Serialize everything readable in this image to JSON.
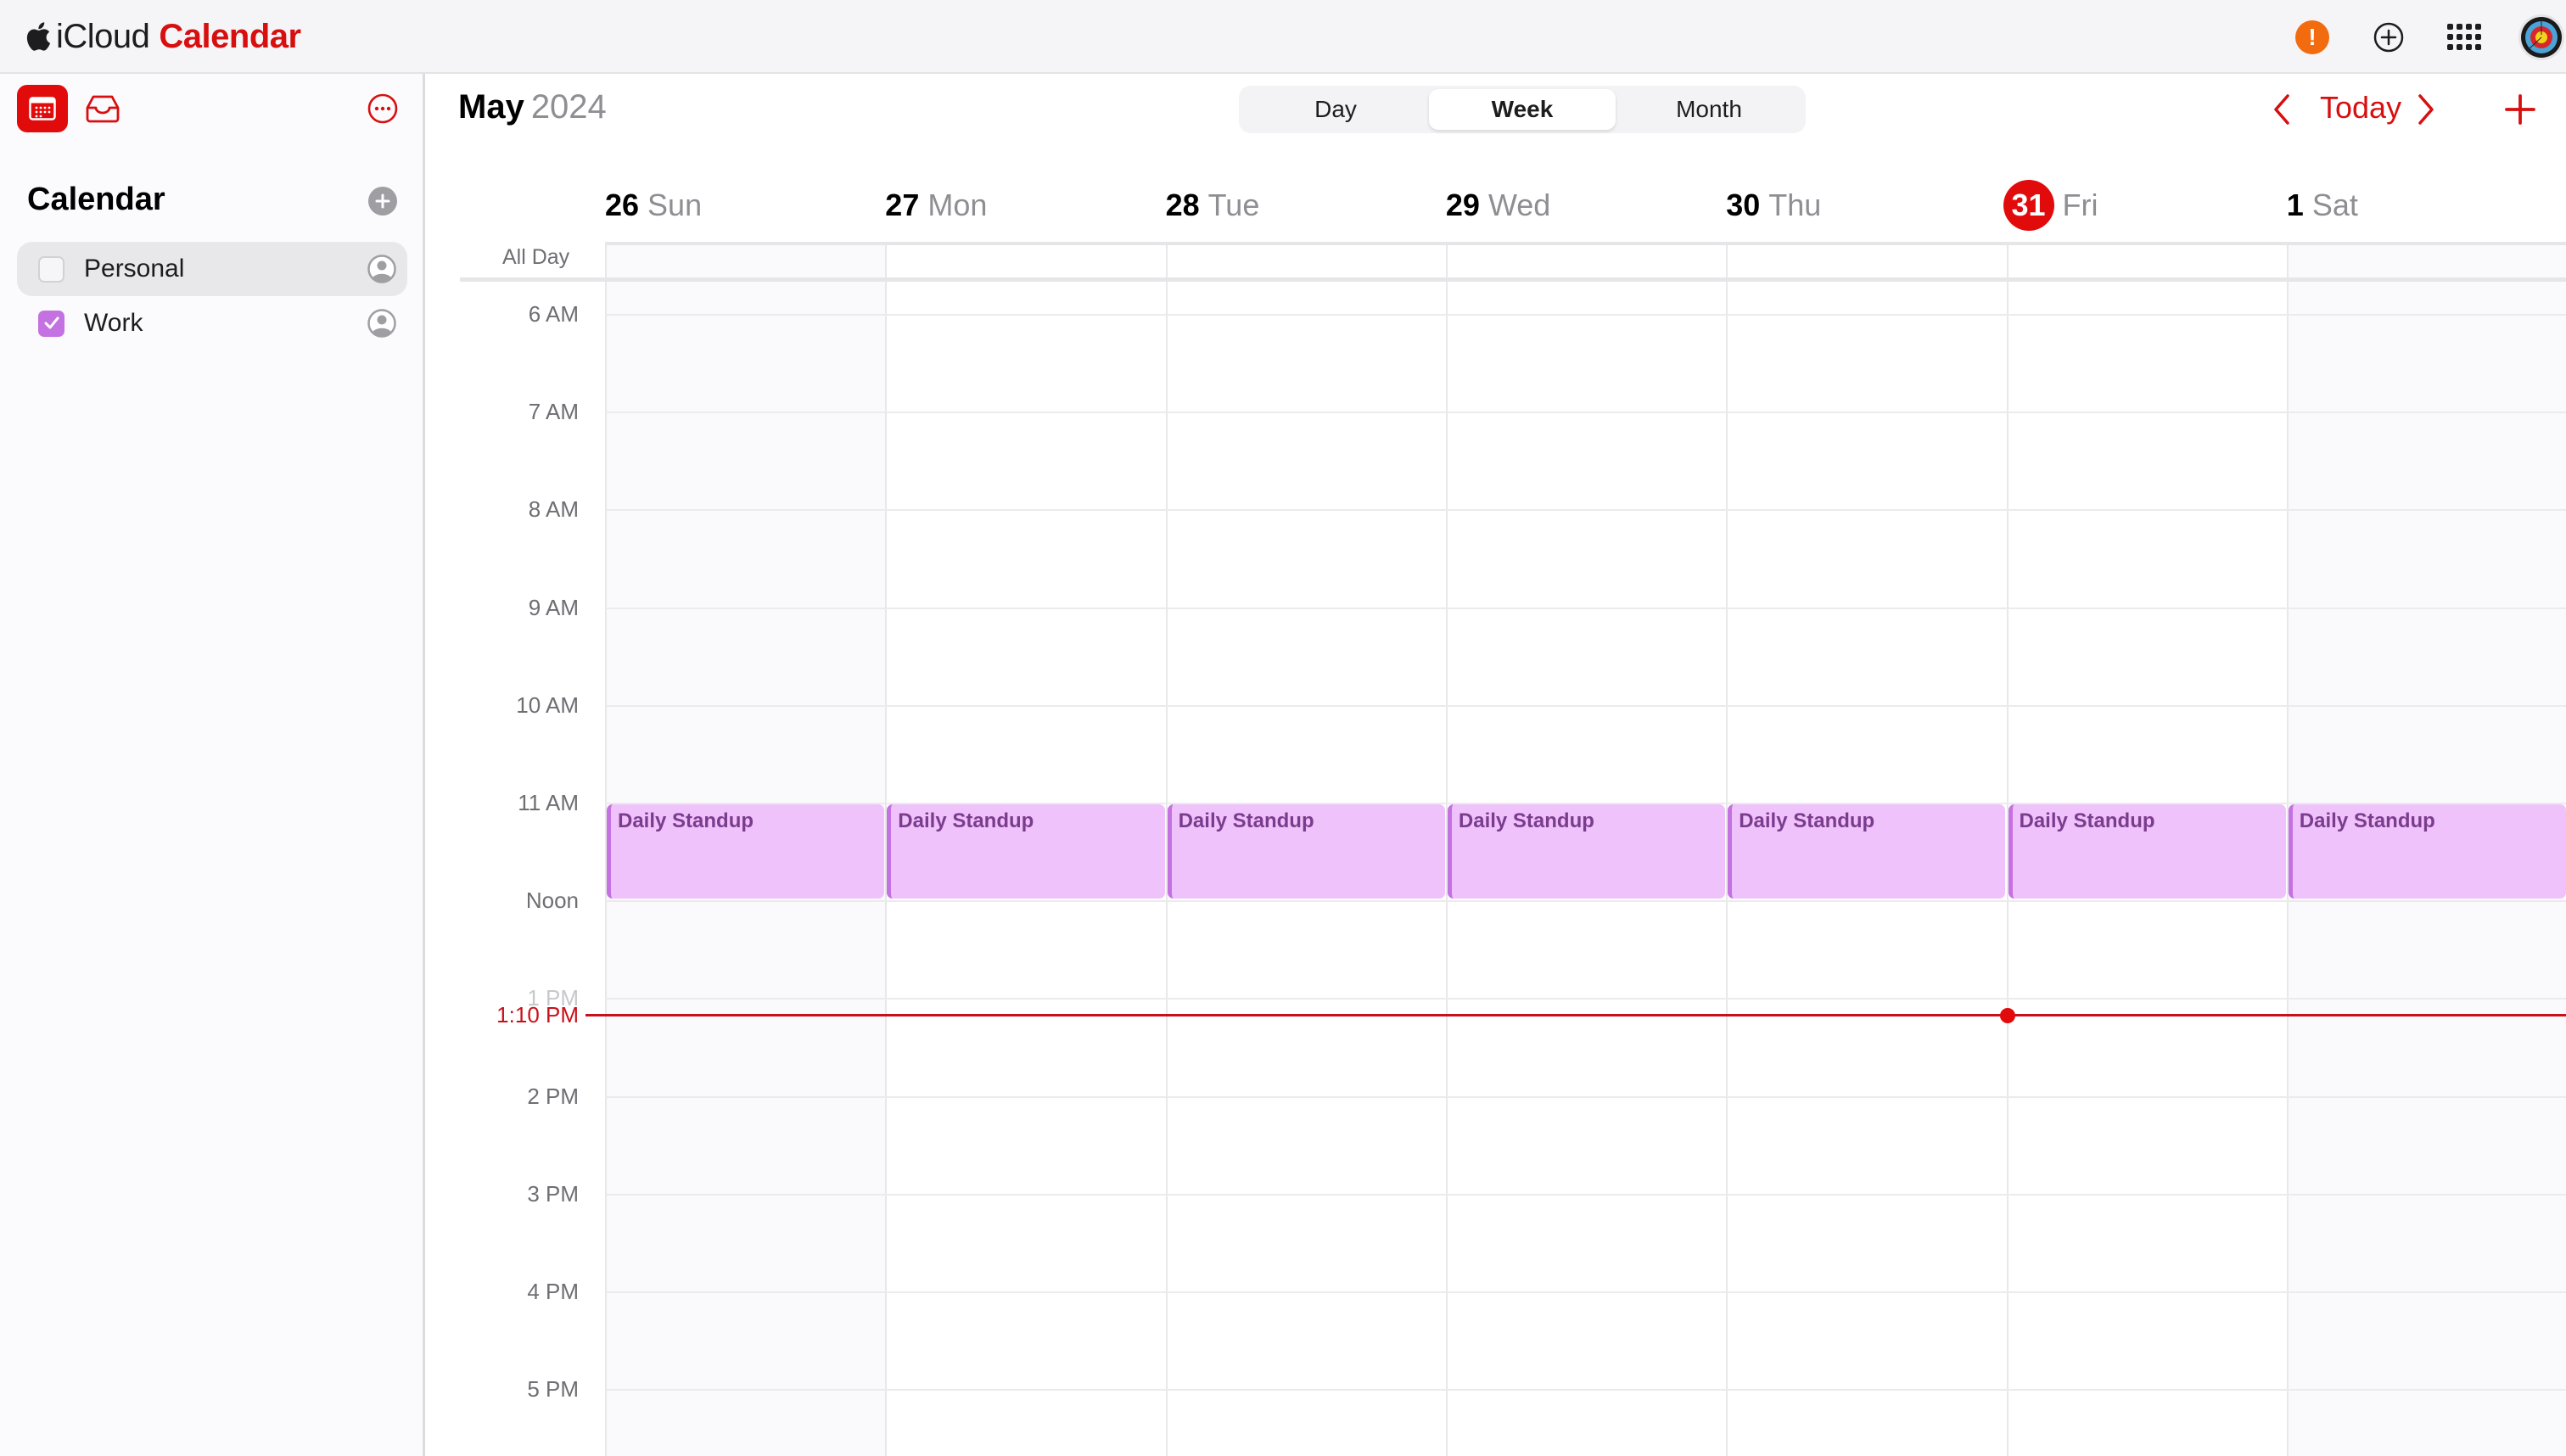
{
  "app": {
    "brand_prefix": "iCloud",
    "brand_name": "Calendar",
    "accent_color": "#d70f0f"
  },
  "topbar": {
    "icons": [
      "alert-icon",
      "add-circle-icon",
      "app-grid-icon",
      "avatar"
    ],
    "alert_glyph": "!"
  },
  "sidebar": {
    "title": "Calendar",
    "calendars": [
      {
        "label": "Personal",
        "checked": false,
        "selected": true,
        "color": "#d2d2d6"
      },
      {
        "label": "Work",
        "checked": true,
        "selected": false,
        "color": "#c471e1"
      }
    ]
  },
  "header": {
    "month": "May",
    "year": "2024",
    "views": [
      {
        "label": "Day",
        "active": false
      },
      {
        "label": "Week",
        "active": true
      },
      {
        "label": "Month",
        "active": false
      }
    ],
    "today_label": "Today"
  },
  "week": {
    "days": [
      {
        "num": "26",
        "dow": "Sun",
        "today": false,
        "weekend": true
      },
      {
        "num": "27",
        "dow": "Mon",
        "today": false,
        "weekend": false
      },
      {
        "num": "28",
        "dow": "Tue",
        "today": false,
        "weekend": false
      },
      {
        "num": "29",
        "dow": "Wed",
        "today": false,
        "weekend": false
      },
      {
        "num": "30",
        "dow": "Thu",
        "today": false,
        "weekend": false
      },
      {
        "num": "31",
        "dow": "Fri",
        "today": true,
        "weekend": false
      },
      {
        "num": "1",
        "dow": "Sat",
        "today": false,
        "weekend": true
      }
    ],
    "all_day_label": "All Day",
    "hours": [
      "6 AM",
      "7 AM",
      "8 AM",
      "9 AM",
      "10 AM",
      "11 AM",
      "Noon",
      "1 PM",
      "2 PM",
      "3 PM",
      "4 PM",
      "5 PM"
    ],
    "first_hour": 6,
    "now_label": "1:10 PM",
    "now_hour": 13.1667,
    "events": [
      {
        "title": "Daily Standup",
        "day": 0,
        "start": 11,
        "end": 12,
        "calendar": "Work"
      },
      {
        "title": "Daily Standup",
        "day": 1,
        "start": 11,
        "end": 12,
        "calendar": "Work"
      },
      {
        "title": "Daily Standup",
        "day": 2,
        "start": 11,
        "end": 12,
        "calendar": "Work"
      },
      {
        "title": "Daily Standup",
        "day": 3,
        "start": 11,
        "end": 12,
        "calendar": "Work"
      },
      {
        "title": "Daily Standup",
        "day": 4,
        "start": 11,
        "end": 12,
        "calendar": "Work"
      },
      {
        "title": "Daily Standup",
        "day": 5,
        "start": 11,
        "end": 12,
        "calendar": "Work"
      },
      {
        "title": "Daily Standup",
        "day": 6,
        "start": 11,
        "end": 12,
        "calendar": "Work"
      }
    ]
  }
}
